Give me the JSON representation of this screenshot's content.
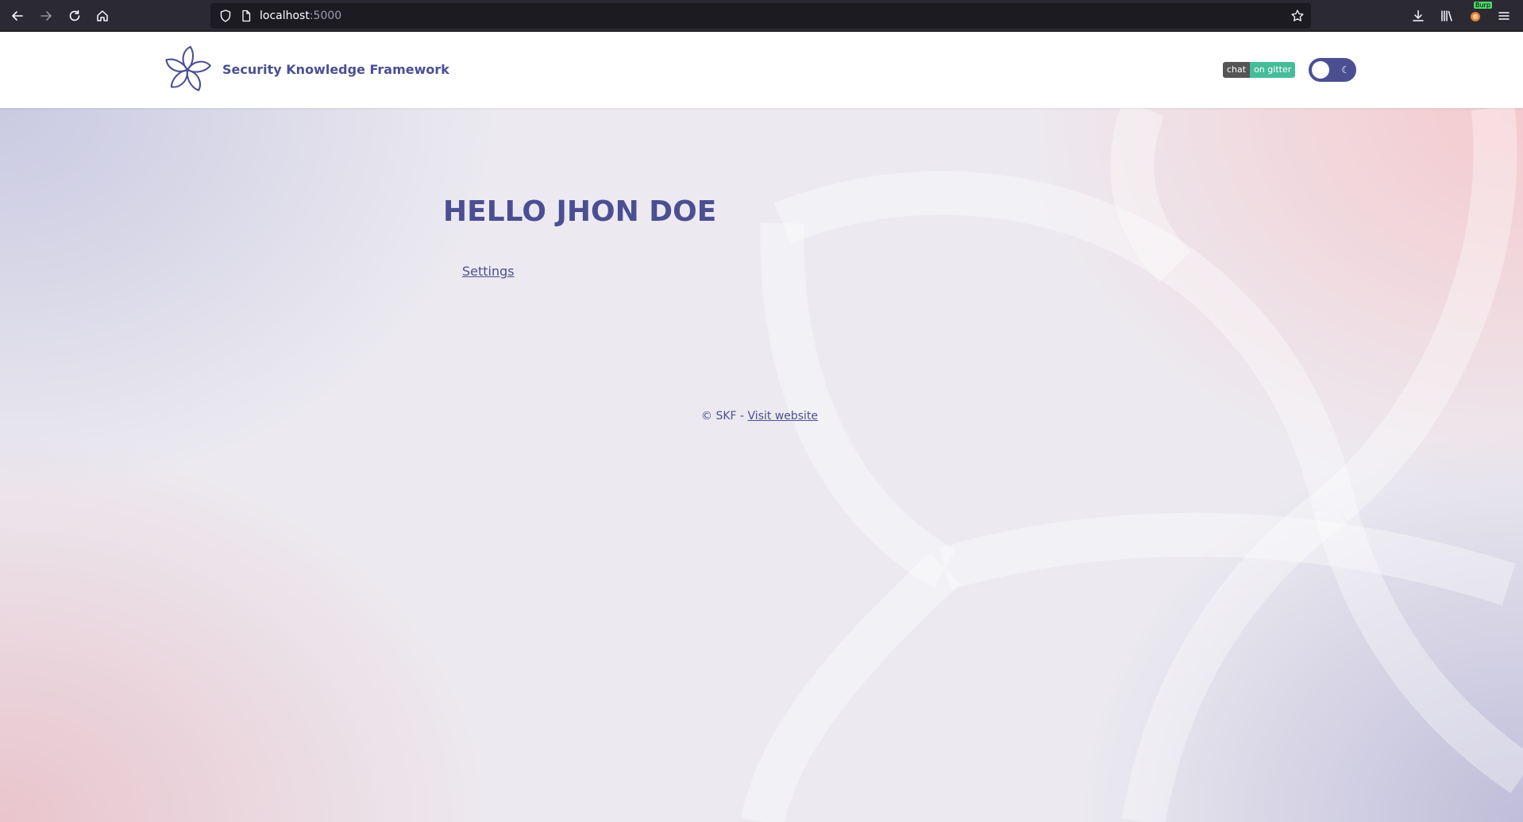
{
  "browser": {
    "url_host": "localhost",
    "url_port": ":5000",
    "extension_badge": "Burp"
  },
  "header": {
    "brand_title": "Security Knowledge Framework",
    "gitter_left": "chat",
    "gitter_right": "on gitter",
    "toggle_glyph": "☾"
  },
  "main": {
    "greeting": "HELLO JHON DOE",
    "settings_link": "Settings"
  },
  "footer": {
    "copyright": "© SKF - ",
    "visit_link": "Visit website"
  },
  "colors": {
    "brand": "#4b4f92",
    "browser_toolbar": "#2b2a33",
    "url_bar": "#1c1b22",
    "gitter_chat": "#555555",
    "gitter_online": "#46bc99"
  },
  "icons": {
    "back": "back-arrow-icon",
    "forward": "forward-arrow-icon",
    "reload": "reload-icon",
    "home": "home-icon",
    "shield": "shield-icon",
    "page": "page-icon",
    "bookmark": "star-icon",
    "downloads": "download-icon",
    "library": "library-icon",
    "extension": "burp-extension-icon",
    "menu": "hamburger-menu-icon",
    "logo": "flower-logo-icon",
    "theme": "moon-icon"
  }
}
